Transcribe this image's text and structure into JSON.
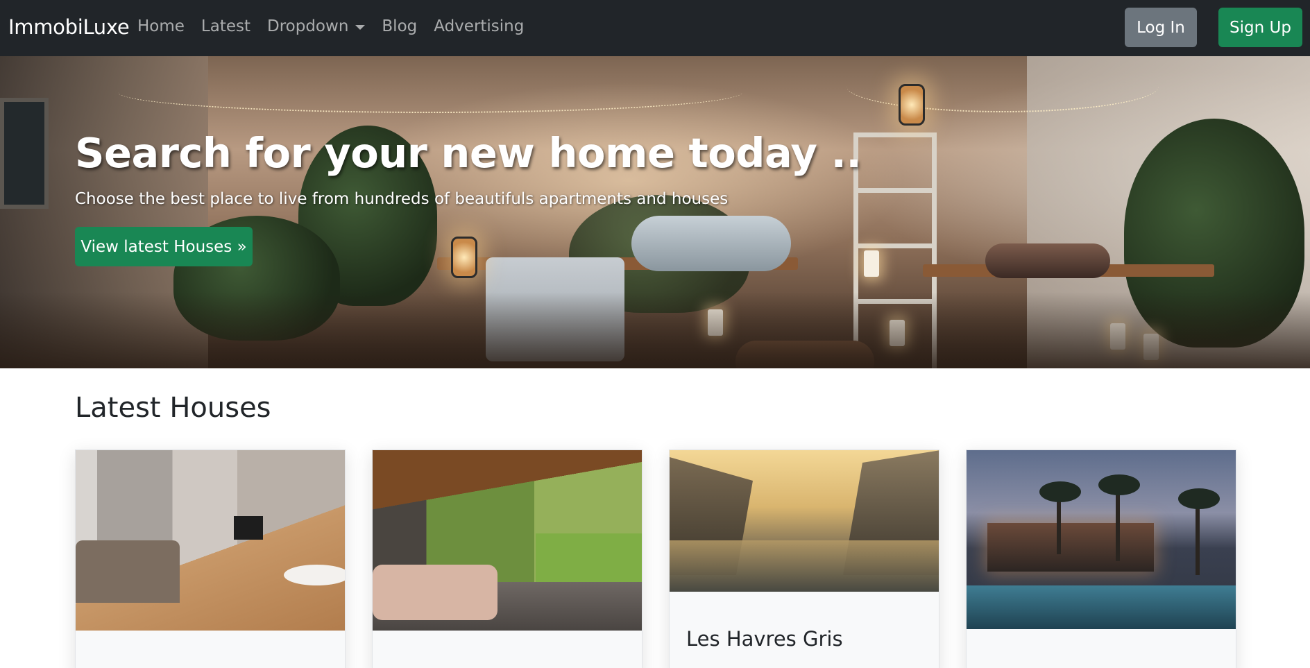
{
  "navbar": {
    "brand": "ImmobiLuxe",
    "links": [
      {
        "label": "Home"
      },
      {
        "label": "Latest"
      },
      {
        "label": "Dropdown"
      },
      {
        "label": "Blog"
      },
      {
        "label": "Advertising"
      }
    ],
    "login_label": "Log In",
    "signup_label": "Sign Up"
  },
  "hero": {
    "title": "Search for your new home today ..",
    "subtitle": "Choose the best place to live from hundreds of beautifuls apartments and houses",
    "cta_label": "View latest Houses »"
  },
  "latest": {
    "heading": "Latest Houses",
    "cards": [
      {
        "title": "",
        "image": "living-room-photo"
      },
      {
        "title": "",
        "image": "covered-terrace-photo"
      },
      {
        "title": "Les Havres Gris",
        "image": "fantasy-harbor-photo"
      },
      {
        "title": "",
        "image": "tropical-resort-pool-photo"
      }
    ]
  },
  "colors": {
    "navbar_bg": "#212529",
    "primary_green": "#198754",
    "secondary_gray": "#6c757d"
  }
}
